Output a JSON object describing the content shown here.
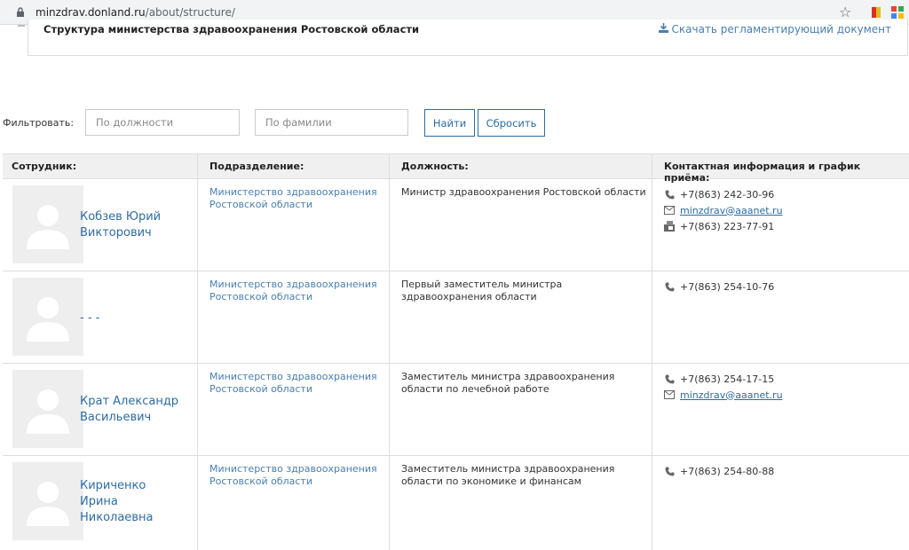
{
  "browser": {
    "url_domain": "minzdrav.donland.ru",
    "url_path": "/about/structure/"
  },
  "header": {
    "title": "Структура министерства здравоохранения Ростовской области",
    "download_link": "Скачать регламентирующий документ"
  },
  "filter": {
    "label": "Фильтровать:",
    "position_placeholder": "По должности",
    "surname_placeholder": "По фамилии",
    "find_button": "Найти",
    "reset_button": "Сбросить"
  },
  "table": {
    "headers": {
      "employee": "Сотрудник:",
      "department": "Подразделение:",
      "position": "Должность:",
      "contacts": "Контактная информация и график приёма:"
    },
    "rows": [
      {
        "name_line1": "Кобзев Юрий",
        "name_line2": "Викторович",
        "name_line3": "",
        "dept_line1": "Министерство здравоохранения",
        "dept_line2": "Ростовской области",
        "pos_line1": "Министр здравоохранения Ростовской области",
        "pos_line2": "",
        "phone": "+7(863) 242-30-96",
        "email": "minzdrav@aaanet.ru",
        "fax": "+7(863) 223-77-91"
      },
      {
        "name_line1": "- - -",
        "name_line2": "",
        "name_line3": "",
        "dept_line1": "Министерство здравоохранения",
        "dept_line2": "Ростовской области",
        "pos_line1": "Первый заместитель министра",
        "pos_line2": "здравоохранения области",
        "phone": "+7(863) 254-10-76",
        "email": "",
        "fax": ""
      },
      {
        "name_line1": "Крат Александр",
        "name_line2": "Васильевич",
        "name_line3": "",
        "dept_line1": "Министерство здравоохранения",
        "dept_line2": "Ростовской области",
        "pos_line1": "Заместитель министра здравоохранения",
        "pos_line2": "области по лечебной работе",
        "phone": "+7(863) 254-17-15",
        "email": "minzdrav@aaanet.ru",
        "fax": ""
      },
      {
        "name_line1": "Кириченко",
        "name_line2": "Ирина",
        "name_line3": "Николаевна",
        "dept_line1": "Министерство здравоохранения",
        "dept_line2": "Ростовской области",
        "pos_line1": "Заместитель министра здравоохранения",
        "pos_line2": "области по экономике и финансам",
        "phone": "+7(863) 254-80-88",
        "email": "",
        "fax": ""
      }
    ]
  },
  "colors": {
    "link": "#2d6ca2",
    "header_bg": "#f0f0f0",
    "avatar_bg": "#eeeeee"
  },
  "icons": [
    "lock-icon",
    "star-icon",
    "extension-icon",
    "download-icon",
    "phone-icon",
    "email-icon",
    "fax-icon",
    "avatar-placeholder-icon"
  ]
}
